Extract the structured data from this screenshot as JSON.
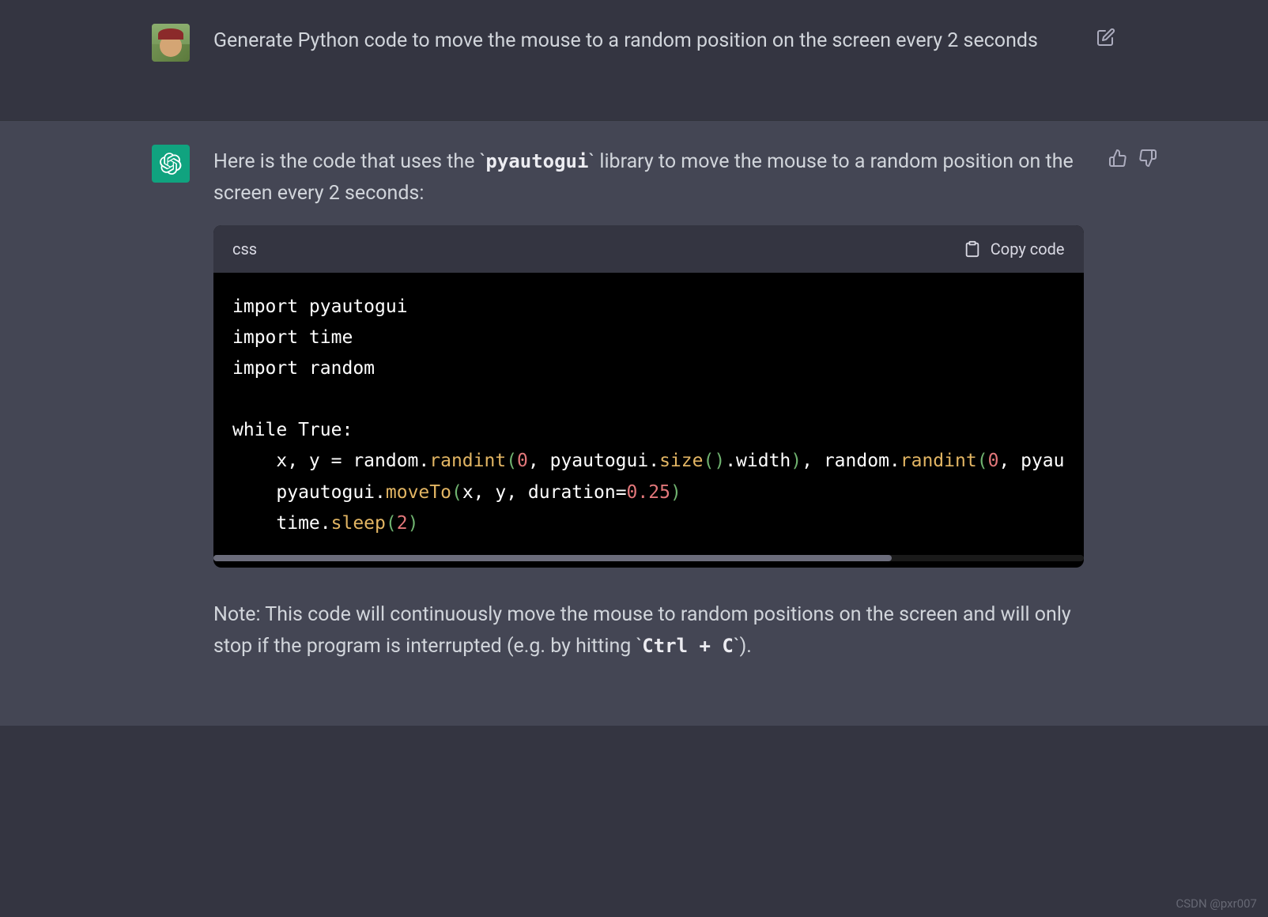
{
  "user": {
    "message": "Generate Python code to move the mouse to a random position on the screen every 2 seconds"
  },
  "assistant": {
    "intro_before": "Here is the code that uses the ",
    "intro_code": "pyautogui",
    "intro_after": " library to move the mouse to a random position on the screen every 2 seconds:",
    "code": {
      "language": "css",
      "copy_label": "Copy code",
      "lines": [
        "import pyautogui",
        "import time",
        "import random",
        "",
        "while True:",
        "    x, y = random.randint(0, pyautogui.size().width), random.randint(0, pyau",
        "    pyautogui.moveTo(x, y, duration=0.25)",
        "    time.sleep(2)"
      ]
    },
    "note_before": "Note: This code will continuously move the mouse to random positions on the screen and will only stop if the program is interrupted (e.g. by hitting ",
    "note_code": "Ctrl + C",
    "note_after": ")."
  },
  "watermark": "CSDN @pxr007"
}
